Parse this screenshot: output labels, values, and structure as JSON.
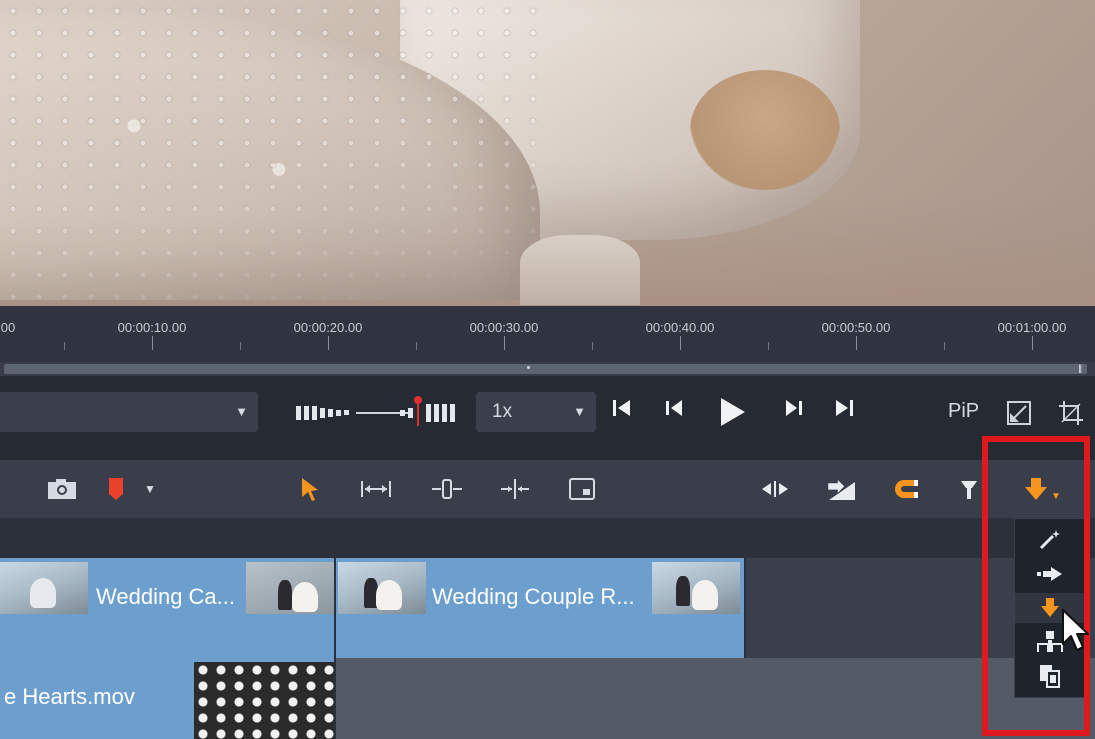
{
  "timeline": {
    "ruler_labels": [
      "00",
      "00:00:10.00",
      "00:00:20.00",
      "00:00:30.00",
      "00:00:40.00",
      "00:00:50.00",
      "00:01:00.00"
    ]
  },
  "transport": {
    "speed_value": "1x",
    "pip_label": "PiP"
  },
  "toolbar": {
    "icons": [
      "camera-icon",
      "marker-icon",
      "select-arrow-icon",
      "trim-icon",
      "slip-icon",
      "slide-icon",
      "crop-icon",
      "split-icon",
      "insert-icon",
      "magnet-icon",
      "ripple-icon",
      "overwrite-mode-icon"
    ]
  },
  "dropdown": {
    "items": [
      "smart-mode-icon",
      "insert-mode-icon",
      "overwrite-mode-icon",
      "replace-mode-icon",
      "copy-mode-icon"
    ],
    "selected": "overwrite-mode-icon"
  },
  "tracks": {
    "clip1_label": "Wedding Ca...",
    "clip2_label": "Wedding Couple R...",
    "clip3_label": "e Hearts.mov"
  },
  "colors": {
    "accent_orange": "#f7941d",
    "clip_blue": "#6c9fce",
    "highlight_red": "#e0191e",
    "playhead_red": "#e03030"
  }
}
